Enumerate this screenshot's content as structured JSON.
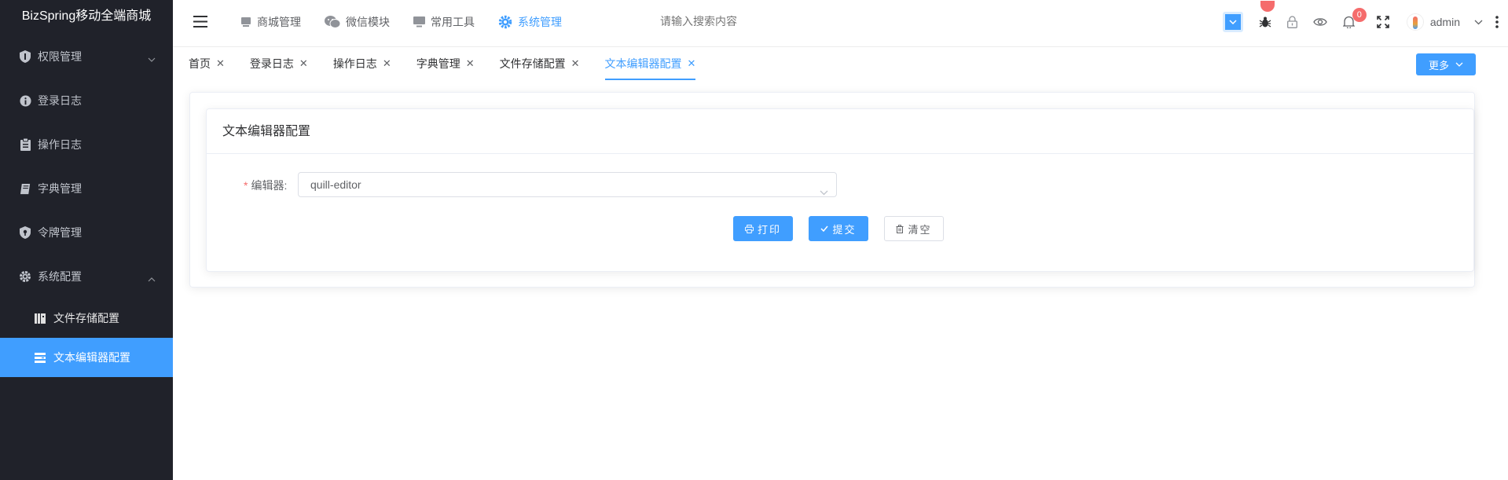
{
  "app": {
    "title": "BizSpring移动全端商城"
  },
  "sidebar": {
    "items": [
      {
        "label": "权限管理",
        "icon": "shield-icon",
        "expandable": true
      },
      {
        "label": "登录日志",
        "icon": "info-icon"
      },
      {
        "label": "操作日志",
        "icon": "clipboard-icon"
      },
      {
        "label": "字典管理",
        "icon": "book-icon"
      },
      {
        "label": "令牌管理",
        "icon": "token-shield-icon"
      },
      {
        "label": "系统配置",
        "icon": "gear-icon",
        "expanded": true
      }
    ],
    "subitems": [
      {
        "label": "文件存储配置",
        "icon": "storage-icon"
      },
      {
        "label": "文本编辑器配置",
        "icon": "list-icon",
        "active": true
      }
    ]
  },
  "header": {
    "nav": [
      {
        "label": "商城管理",
        "icon": "shop-icon"
      },
      {
        "label": "微信模块",
        "icon": "wechat-icon"
      },
      {
        "label": "常用工具",
        "icon": "monitor-icon"
      },
      {
        "label": "系统管理",
        "icon": "gear-icon",
        "active": true
      }
    ],
    "search_placeholder": "请输入搜索内容",
    "notification_count": "0",
    "user": "admin"
  },
  "tabs": {
    "items": [
      {
        "label": "首页"
      },
      {
        "label": "登录日志"
      },
      {
        "label": "操作日志"
      },
      {
        "label": "字典管理"
      },
      {
        "label": "文件存储配置"
      },
      {
        "label": "文本编辑器配置",
        "active": true
      }
    ],
    "more_label": "更多"
  },
  "page": {
    "card_title": "文本编辑器配置",
    "form": {
      "editor_label": "编辑器:",
      "editor_value": "quill-editor"
    },
    "buttons": {
      "print": "打印",
      "submit": "提交",
      "clear": "清空"
    }
  },
  "colors": {
    "accent": "#409eff",
    "sidebar_bg": "#20222a",
    "danger": "#f56c6c"
  }
}
